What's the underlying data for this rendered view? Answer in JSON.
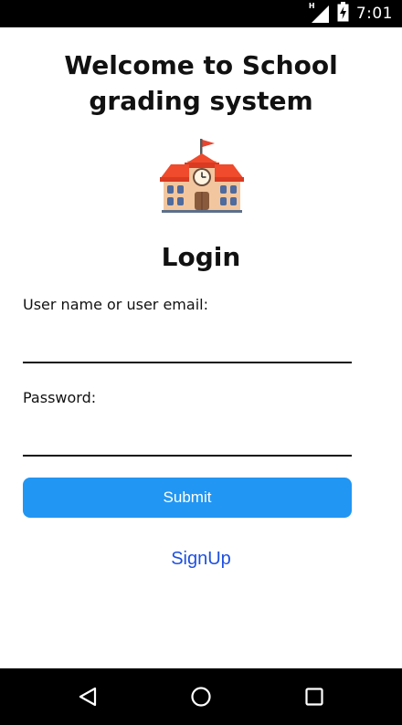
{
  "status_bar": {
    "time": "7:01",
    "network_label": "H",
    "icons": [
      "signal-icon",
      "battery-charging-icon"
    ]
  },
  "page": {
    "welcome_title": "Welcome to School grading system",
    "image_icon": "school-building-icon",
    "login_heading": "Login"
  },
  "form": {
    "username_label": "User name or user email:",
    "username_value": "",
    "password_label": "Password:",
    "password_value": "",
    "submit_label": "Submit",
    "signup_label": "SignUp"
  },
  "nav_bar": {
    "icons": [
      "back-icon",
      "home-icon",
      "recents-icon"
    ]
  },
  "colors": {
    "status_bar_bg": "#000000",
    "nav_bar_bg": "#000000",
    "submit_bg": "#2196f3",
    "link": "#1e50e0",
    "text": "#111111"
  }
}
